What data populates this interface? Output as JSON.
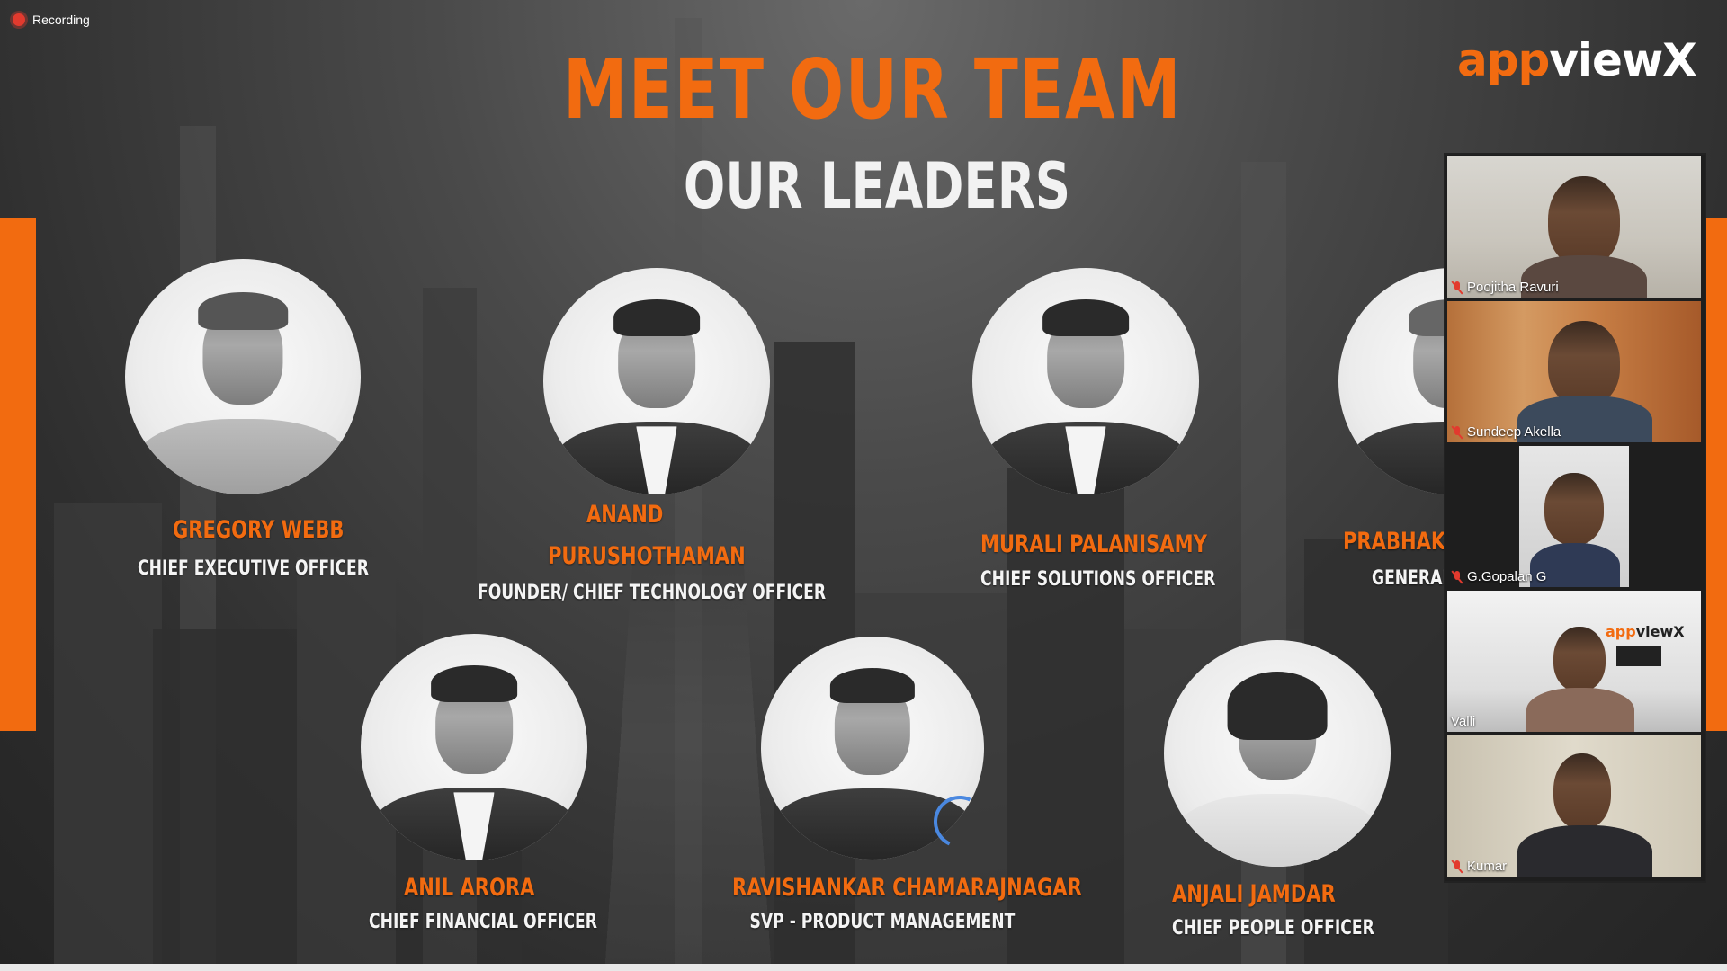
{
  "recording": {
    "label": "Recording"
  },
  "slide": {
    "title": "MEET OUR TEAM",
    "subtitle": "OUR LEADERS",
    "logo": {
      "part1": "app",
      "part2": "viewX"
    },
    "leaders": [
      {
        "name": "GREGORY WEBB",
        "role": "CHIEF EXECUTIVE OFFICER"
      },
      {
        "name": "ANAND",
        "name2": "PURUSHOTHAMAN",
        "role": "FOUNDER/ CHIEF TECHNOLOGY OFFICER"
      },
      {
        "name": "MURALI PALANISAMY",
        "role": "CHIEF SOLUTIONS OFFICER"
      },
      {
        "name": "PRABHAKA",
        "role": "GENERAL"
      },
      {
        "name": "ANIL ARORA",
        "role": "CHIEF FINANCIAL OFFICER"
      },
      {
        "name": "RAVISHANKAR CHAMARAJNAGAR",
        "role": "SVP  - PRODUCT MANAGEMENT"
      },
      {
        "name": "ANJALI JAMDAR",
        "role": "CHIEF PEOPLE OFFICER"
      }
    ]
  },
  "participants": [
    {
      "name": "Poojitha Ravuri",
      "muted": true
    },
    {
      "name": "Sundeep Akella",
      "muted": true
    },
    {
      "name": "G.Gopalan G",
      "muted": true
    },
    {
      "name": "Valli",
      "muted": false,
      "active": true
    },
    {
      "name": "Kumar",
      "muted": true
    }
  ],
  "colors": {
    "accent": "#f26b10",
    "active_speaker": "#8bc34a",
    "muted": "#e23a2e"
  }
}
